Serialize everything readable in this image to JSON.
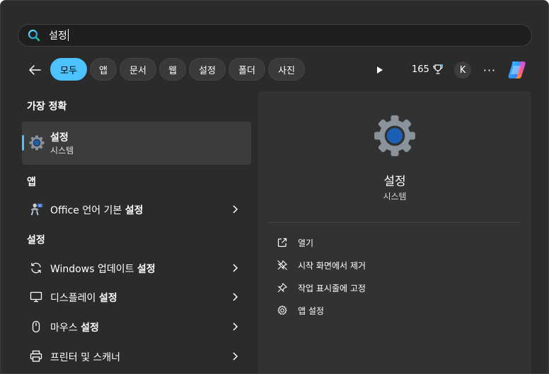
{
  "search": {
    "value": "설정"
  },
  "filters": [
    {
      "label": "모두",
      "active": true
    },
    {
      "label": "앱",
      "active": false
    },
    {
      "label": "문서",
      "active": false
    },
    {
      "label": "웹",
      "active": false
    },
    {
      "label": "설정",
      "active": false
    },
    {
      "label": "폴더",
      "active": false
    },
    {
      "label": "사진",
      "active": false
    }
  ],
  "header": {
    "points": "165",
    "avatar_initial": "K",
    "more_label": "···"
  },
  "sections": {
    "best_match_title": "가장 정확",
    "apps_title": "앱",
    "settings_title": "설정"
  },
  "best_match": {
    "name": "설정",
    "subtitle": "시스템"
  },
  "apps": [
    {
      "prefix": "Office 언어 기본 ",
      "bold": "설정",
      "icon": "office-language-icon"
    }
  ],
  "settings_results": [
    {
      "prefix": "Windows 업데이트 ",
      "bold": "설정",
      "icon": "refresh-icon"
    },
    {
      "prefix": "디스플레이 ",
      "bold": "설정",
      "icon": "monitor-icon"
    },
    {
      "prefix": "마우스 ",
      "bold": "설정",
      "icon": "mouse-icon"
    },
    {
      "prefix": "프린터 및 스캐너",
      "bold": "",
      "icon": "printer-icon"
    }
  ],
  "detail": {
    "title": "설정",
    "subtitle": "시스템",
    "actions": [
      {
        "label": "열기",
        "icon": "open-external-icon"
      },
      {
        "label": "시작 화면에서 제거",
        "icon": "unpin-icon"
      },
      {
        "label": "작업 표시줄에 고정",
        "icon": "pin-icon"
      },
      {
        "label": "앱 설정",
        "icon": "gear-icon"
      }
    ]
  },
  "colors": {
    "accent": "#4cc2ff",
    "panel": "#2b2b2b",
    "pane": "#323232"
  }
}
